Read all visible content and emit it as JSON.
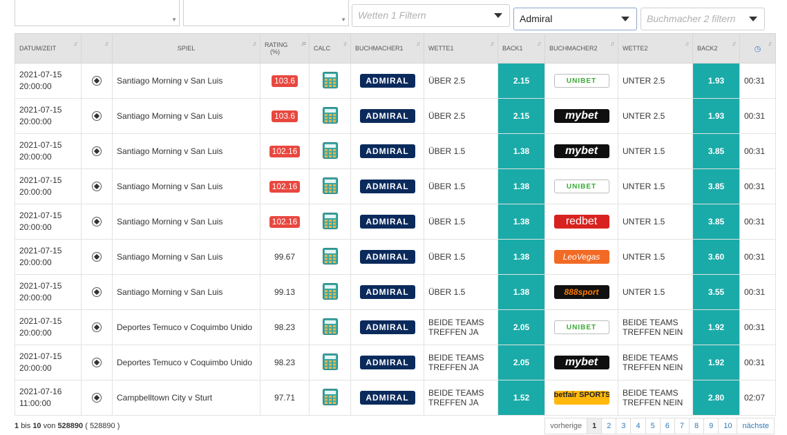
{
  "filters": {
    "wetten1_placeholder": "Wetten 1 Filtern",
    "bookmaker1_selected": "Admiral",
    "bookmaker2_placeholder": "Buchmacher 2 filtern"
  },
  "table": {
    "headers": {
      "datetime": "DATUM/ZEIT",
      "game": "SPIEL",
      "rating": "RATING (%)",
      "calc": "CALC",
      "bookmaker1": "BUCHMACHER1",
      "bet1": "WETTE1",
      "back1": "BACK1",
      "bookmaker2": "BUCHMACHER2",
      "bet2": "WETTE2",
      "back2": "BACK2"
    },
    "rows": [
      {
        "date": "2021-07-15",
        "time": "20:00:00",
        "game": "Santiago Morning v San Luis",
        "rating": "103.6",
        "highlight": true,
        "bm1": "ADMIRAL",
        "bet1": "ÜBER 2.5",
        "back1": "2.15",
        "bm2": "unibet",
        "bm2_text": "UNIBET",
        "bet2": "UNTER 2.5",
        "back2": "1.93",
        "remaining": "00:31"
      },
      {
        "date": "2021-07-15",
        "time": "20:00:00",
        "game": "Santiago Morning v San Luis",
        "rating": "103.6",
        "highlight": true,
        "bm1": "ADMIRAL",
        "bet1": "ÜBER 2.5",
        "back1": "2.15",
        "bm2": "mybet",
        "bm2_text": "mybet",
        "bet2": "UNTER 2.5",
        "back2": "1.93",
        "remaining": "00:31"
      },
      {
        "date": "2021-07-15",
        "time": "20:00:00",
        "game": "Santiago Morning v San Luis",
        "rating": "102.16",
        "highlight": true,
        "bm1": "ADMIRAL",
        "bet1": "ÜBER 1.5",
        "back1": "1.38",
        "bm2": "mybet",
        "bm2_text": "mybet",
        "bet2": "UNTER 1.5",
        "back2": "3.85",
        "remaining": "00:31"
      },
      {
        "date": "2021-07-15",
        "time": "20:00:00",
        "game": "Santiago Morning v San Luis",
        "rating": "102.16",
        "highlight": true,
        "bm1": "ADMIRAL",
        "bet1": "ÜBER 1.5",
        "back1": "1.38",
        "bm2": "unibet",
        "bm2_text": "UNIBET",
        "bet2": "UNTER 1.5",
        "back2": "3.85",
        "remaining": "00:31"
      },
      {
        "date": "2021-07-15",
        "time": "20:00:00",
        "game": "Santiago Morning v San Luis",
        "rating": "102.16",
        "highlight": true,
        "bm1": "ADMIRAL",
        "bet1": "ÜBER 1.5",
        "back1": "1.38",
        "bm2": "redbet",
        "bm2_text": "redbet",
        "bet2": "UNTER 1.5",
        "back2": "3.85",
        "remaining": "00:31"
      },
      {
        "date": "2021-07-15",
        "time": "20:00:00",
        "game": "Santiago Morning v San Luis",
        "rating": "99.67",
        "highlight": false,
        "bm1": "ADMIRAL",
        "bet1": "ÜBER 1.5",
        "back1": "1.38",
        "bm2": "leovegas",
        "bm2_text": "LeoVegas",
        "bet2": "UNTER 1.5",
        "back2": "3.60",
        "remaining": "00:31"
      },
      {
        "date": "2021-07-15",
        "time": "20:00:00",
        "game": "Santiago Morning v San Luis",
        "rating": "99.13",
        "highlight": false,
        "bm1": "ADMIRAL",
        "bet1": "ÜBER 1.5",
        "back1": "1.38",
        "bm2": "sport888",
        "bm2_text": "888sport",
        "bet2": "UNTER 1.5",
        "back2": "3.55",
        "remaining": "00:31"
      },
      {
        "date": "2021-07-15",
        "time": "20:00:00",
        "game": "Deportes Temuco v Coquimbo Unido",
        "rating": "98.23",
        "highlight": false,
        "bm1": "ADMIRAL",
        "bet1": "BEIDE TEAMS TREFFEN JA",
        "back1": "2.05",
        "bm2": "unibet",
        "bm2_text": "UNIBET",
        "bet2": "BEIDE TEAMS TREFFEN NEIN",
        "back2": "1.92",
        "remaining": "00:31"
      },
      {
        "date": "2021-07-15",
        "time": "20:00:00",
        "game": "Deportes Temuco v Coquimbo Unido",
        "rating": "98.23",
        "highlight": false,
        "bm1": "ADMIRAL",
        "bet1": "BEIDE TEAMS TREFFEN JA",
        "back1": "2.05",
        "bm2": "mybet",
        "bm2_text": "mybet",
        "bet2": "BEIDE TEAMS TREFFEN NEIN",
        "back2": "1.92",
        "remaining": "00:31"
      },
      {
        "date": "2021-07-16",
        "time": "11:00:00",
        "game": "Campbelltown City v Sturt",
        "rating": "97.71",
        "highlight": false,
        "bm1": "ADMIRAL",
        "bet1": "BEIDE TEAMS TREFFEN JA",
        "back1": "1.52",
        "bm2": "betfair",
        "bm2_text": "betfair SPORTSBOOK",
        "bet2": "BEIDE TEAMS TREFFEN NEIN",
        "back2": "2.80",
        "remaining": "02:07"
      }
    ]
  },
  "pagination": {
    "from": "1",
    "bis_label": "bis",
    "to": "10",
    "von_label": "von",
    "total": "528890",
    "total_paren": "( 528890 )",
    "prev_label": "vorherige",
    "next_label": "nächste",
    "pages": [
      "1",
      "2",
      "3",
      "4",
      "5",
      "6",
      "7",
      "8",
      "9",
      "10"
    ],
    "active_page": "1"
  },
  "colors": {
    "teal": "#1aaba8",
    "rating_badge": "#e8473f",
    "admiral_navy": "#0b2a5c"
  },
  "icons": {
    "sport": "soccer-ball-icon",
    "calc": "calculator-icon",
    "clock": "clock-icon",
    "sort": "sort-arrows-icon"
  }
}
